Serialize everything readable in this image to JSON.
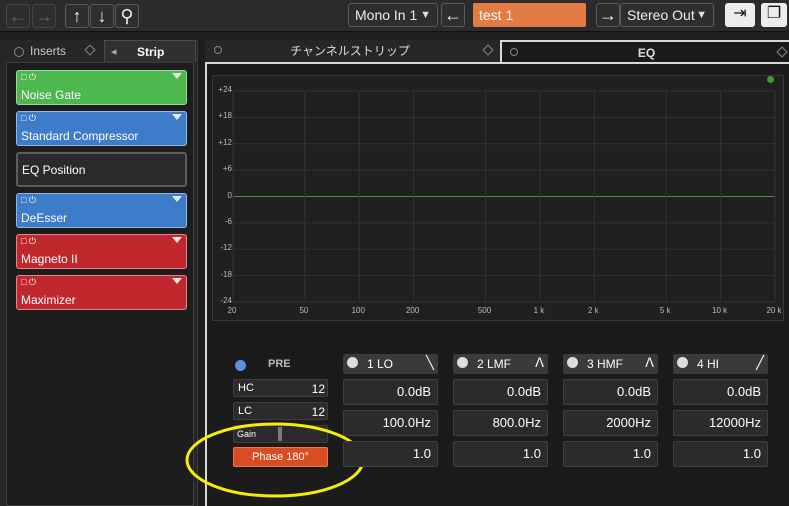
{
  "toolbar": {
    "back_icon": "←",
    "forward_icon": "→",
    "up_icon": "↑",
    "down_icon": "↓",
    "search_icon": "⚲",
    "input_routing": "Mono In 1",
    "routing_arrow": "←",
    "track_name": "test 1",
    "output_arrow": "→",
    "output_routing": "Stereo Out",
    "dropdown_arrow": "▼",
    "route_icon": "⇥",
    "window_icon": "❐"
  },
  "left_tabs": {
    "inserts": "Inserts",
    "strip": "Strip"
  },
  "strip_modules": [
    {
      "label": "Noise Gate",
      "color": "green"
    },
    {
      "label": "Standard Compressor",
      "color": "blue"
    },
    {
      "label": "EQ Position",
      "color": "gray"
    },
    {
      "label": "DeEsser",
      "color": "blue"
    },
    {
      "label": "Magneto II",
      "color": "red"
    },
    {
      "label": "Maximizer",
      "color": "red"
    }
  ],
  "module_icons": "□ ⏻",
  "right_tabs": {
    "channel_strip": "チャンネルストリップ",
    "eq": "EQ"
  },
  "graph": {
    "y_labels": [
      "+24",
      "+18",
      "+12",
      "+6",
      "0",
      "-6",
      "-12",
      "-18",
      "-24"
    ],
    "x_labels": [
      "20",
      "50",
      "100",
      "200",
      "500",
      "1 k",
      "2 k",
      "5 k",
      "10 k",
      "20 k"
    ]
  },
  "pre": {
    "label": "PRE",
    "hc": "HC",
    "hc_value": "12",
    "lc": "LC",
    "lc_value": "12",
    "gain": "Gain",
    "phase": "Phase 180°"
  },
  "bands": [
    {
      "name": "1 LO",
      "gain": "0.0dB",
      "freq": "100.0Hz",
      "q": "1.0"
    },
    {
      "name": "2 LMF",
      "gain": "0.0dB",
      "freq": "800.0Hz",
      "q": "1.0"
    },
    {
      "name": "3 HMF",
      "gain": "0.0dB",
      "freq": "2000Hz",
      "q": "1.0"
    },
    {
      "name": "4 HI",
      "gain": "0.0dB",
      "freq": "12000Hz",
      "q": "1.0"
    }
  ],
  "colors": {
    "accent_orange": "#e37b45",
    "phase_active": "#d94d22",
    "highlight_circle": "#f6f000",
    "curve_green": "#3c9a3c"
  }
}
